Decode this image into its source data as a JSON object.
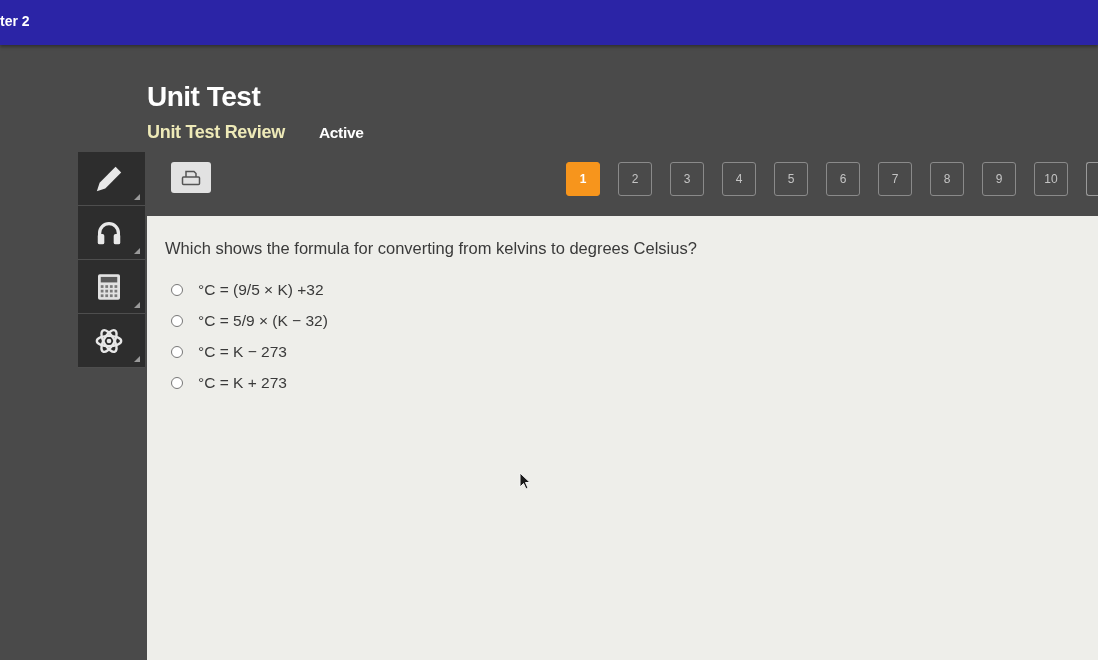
{
  "top_bar": {
    "title": "ter 2"
  },
  "header": {
    "title": "Unit Test",
    "subtitle": "Unit Test Review",
    "status": "Active"
  },
  "question_nav": [
    {
      "label": "1",
      "selected": true
    },
    {
      "label": "2",
      "selected": false
    },
    {
      "label": "3",
      "selected": false
    },
    {
      "label": "4",
      "selected": false
    },
    {
      "label": "5",
      "selected": false
    },
    {
      "label": "6",
      "selected": false
    },
    {
      "label": "7",
      "selected": false
    },
    {
      "label": "8",
      "selected": false
    },
    {
      "label": "9",
      "selected": false
    },
    {
      "label": "10",
      "selected": false
    }
  ],
  "question": {
    "text": "Which shows the formula for converting from kelvins to degrees Celsius?",
    "options": [
      {
        "text": "°C = (9/5 × K) +32",
        "selected": false
      },
      {
        "text": "°C = 5/9 × (K − 32)",
        "selected": false
      },
      {
        "text": "°C = K − 273",
        "selected": false
      },
      {
        "text": "°C = K + 273",
        "selected": false
      }
    ]
  }
}
